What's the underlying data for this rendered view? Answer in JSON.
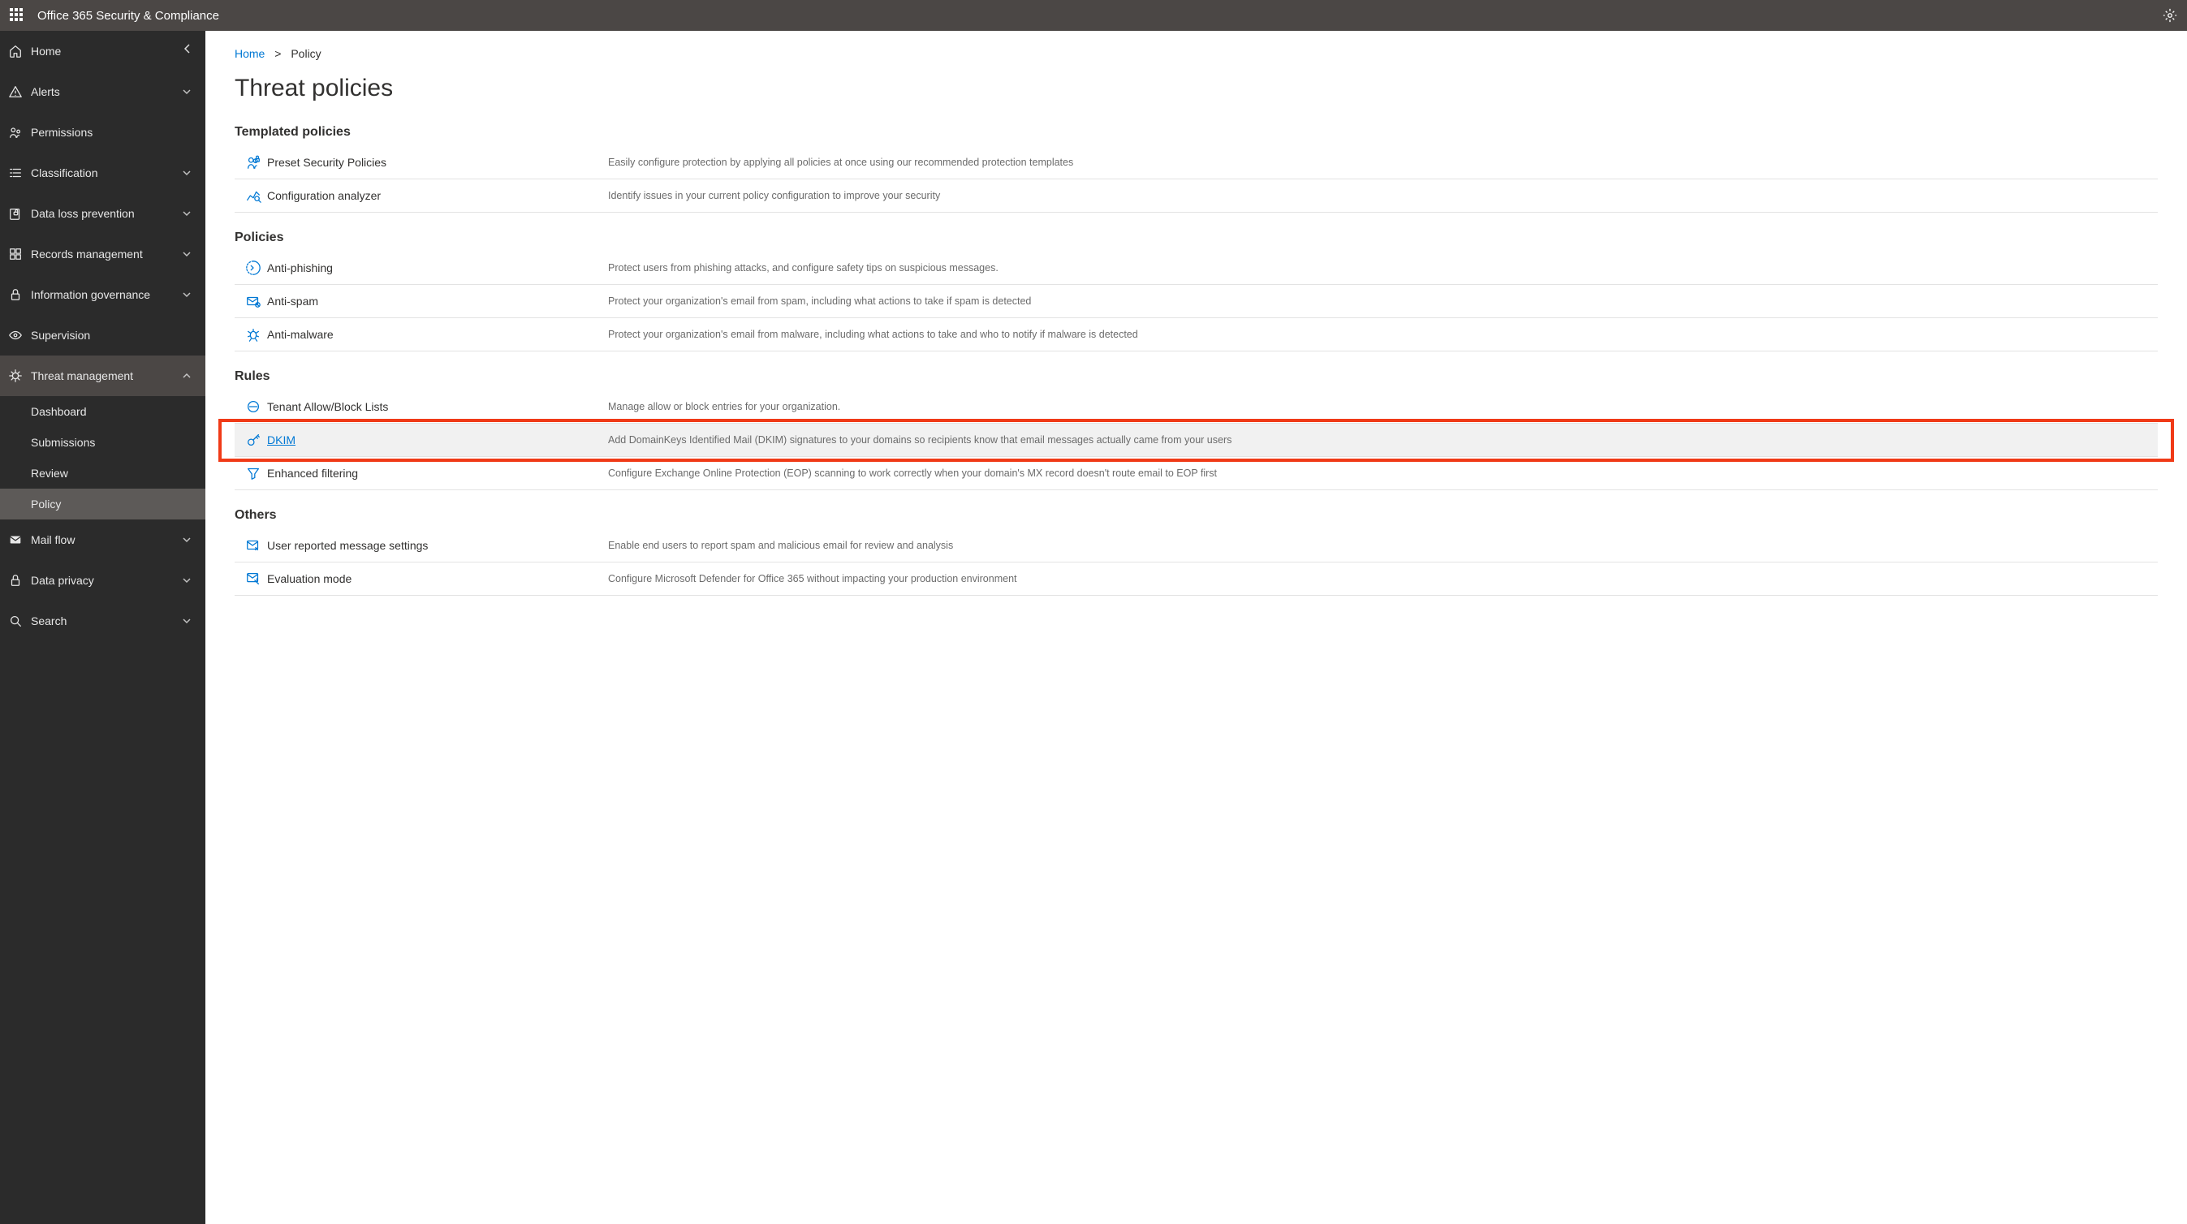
{
  "app_title": "Office 365 Security & Compliance",
  "breadcrumb": {
    "home": "Home",
    "current": "Policy"
  },
  "page_title": "Threat policies",
  "sidebar": {
    "items": [
      {
        "label": "Home",
        "icon": "home",
        "expandable": false
      },
      {
        "label": "Alerts",
        "icon": "alert",
        "expandable": true
      },
      {
        "label": "Permissions",
        "icon": "permissions",
        "expandable": false
      },
      {
        "label": "Classification",
        "icon": "classification",
        "expandable": true
      },
      {
        "label": "Data loss prevention",
        "icon": "dlp",
        "expandable": true
      },
      {
        "label": "Records management",
        "icon": "records",
        "expandable": true
      },
      {
        "label": "Information governance",
        "icon": "lock",
        "expandable": true
      },
      {
        "label": "Supervision",
        "icon": "eye",
        "expandable": false
      },
      {
        "label": "Threat management",
        "icon": "threat",
        "expandable": true,
        "expanded": true,
        "children": [
          {
            "label": "Dashboard"
          },
          {
            "label": "Submissions"
          },
          {
            "label": "Review"
          },
          {
            "label": "Policy",
            "selected": true
          }
        ]
      },
      {
        "label": "Mail flow",
        "icon": "mail",
        "expandable": true
      },
      {
        "label": "Data privacy",
        "icon": "lock",
        "expandable": true
      },
      {
        "label": "Search",
        "icon": "search",
        "expandable": true
      }
    ]
  },
  "sections": [
    {
      "title": "Templated policies",
      "rows": [
        {
          "name": "Preset Security Policies",
          "desc": "Easily configure protection by applying all policies at once using our recommended protection templates",
          "icon": "preset"
        },
        {
          "name": "Configuration analyzer",
          "desc": "Identify issues in your current policy configuration to improve your security",
          "icon": "analyzer"
        }
      ]
    },
    {
      "title": "Policies",
      "rows": [
        {
          "name": "Anti-phishing",
          "desc": "Protect users from phishing attacks, and configure safety tips on suspicious messages.",
          "icon": "phish"
        },
        {
          "name": "Anti-spam",
          "desc": "Protect your organization's email from spam, including what actions to take if spam is detected",
          "icon": "spam"
        },
        {
          "name": "Anti-malware",
          "desc": "Protect your organization's email from malware, including what actions to take and who to notify if malware is detected",
          "icon": "malware"
        }
      ]
    },
    {
      "title": "Rules",
      "rows": [
        {
          "name": "Tenant Allow/Block Lists",
          "desc": "Manage allow or block entries for your organization.",
          "icon": "block"
        },
        {
          "name": "DKIM",
          "desc": "Add DomainKeys Identified Mail (DKIM) signatures to your domains so recipients know that email messages actually came from your users",
          "icon": "key",
          "highlighted": true
        },
        {
          "name": "Enhanced filtering",
          "desc": "Configure Exchange Online Protection (EOP) scanning to work correctly when your domain's MX record doesn't route email to EOP first",
          "icon": "filter"
        }
      ]
    },
    {
      "title": "Others",
      "rows": [
        {
          "name": "User reported message settings",
          "desc": "Enable end users to report spam and malicious email for review and analysis",
          "icon": "report"
        },
        {
          "name": "Evaluation mode",
          "desc": "Configure Microsoft Defender for Office 365 without impacting your production environment",
          "icon": "eval"
        }
      ]
    }
  ]
}
